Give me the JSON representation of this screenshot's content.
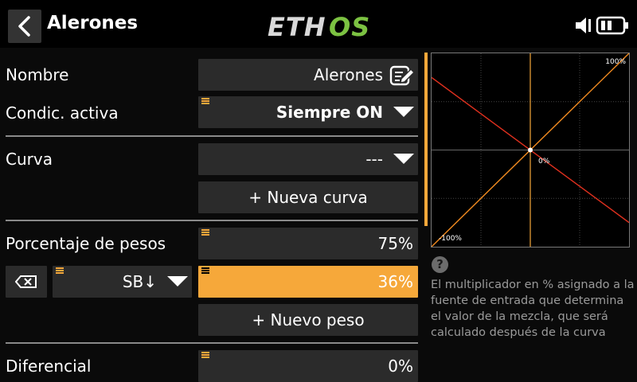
{
  "header": {
    "title": "Alerones",
    "logo_text": "ETHOS",
    "logo_colors": {
      "eth": "#d9d9d9",
      "os": "#7cc242"
    }
  },
  "form": {
    "nombre": {
      "label": "Nombre",
      "value": "Alerones"
    },
    "condicion": {
      "label": "Condic. activa",
      "value": "Siempre ON"
    },
    "curva": {
      "label": "Curva",
      "value": "---",
      "new_button": "+ Nueva curva"
    },
    "pesos": {
      "label": "Porcentaje de pesos",
      "value": "75%",
      "source": "SB↓",
      "source_weight": "36%",
      "new_button": "+ Nuevo peso"
    },
    "diferencial": {
      "label": "Diferencial",
      "value": "0%"
    }
  },
  "chart_data": {
    "type": "line",
    "xlim": [
      -100,
      100
    ],
    "ylim": [
      -100,
      100
    ],
    "grid": true,
    "labels": {
      "top_right": "100%",
      "center": "0%",
      "bottom_left": "-100%"
    },
    "series": [
      {
        "color": "#f28b20",
        "x": [
          -100,
          100
        ],
        "y": [
          -100,
          100
        ]
      },
      {
        "color": "#e0301e",
        "x": [
          -100,
          100
        ],
        "y": [
          75,
          -75
        ]
      }
    ]
  },
  "help": {
    "icon": "?",
    "text": "El multiplicador en % asignado a la fuente de entrada que determina el valor de la mezcla, que será calculado después de la curva"
  },
  "colors": {
    "accent": "#f6a83a",
    "field_bg": "#2b2b2b"
  }
}
